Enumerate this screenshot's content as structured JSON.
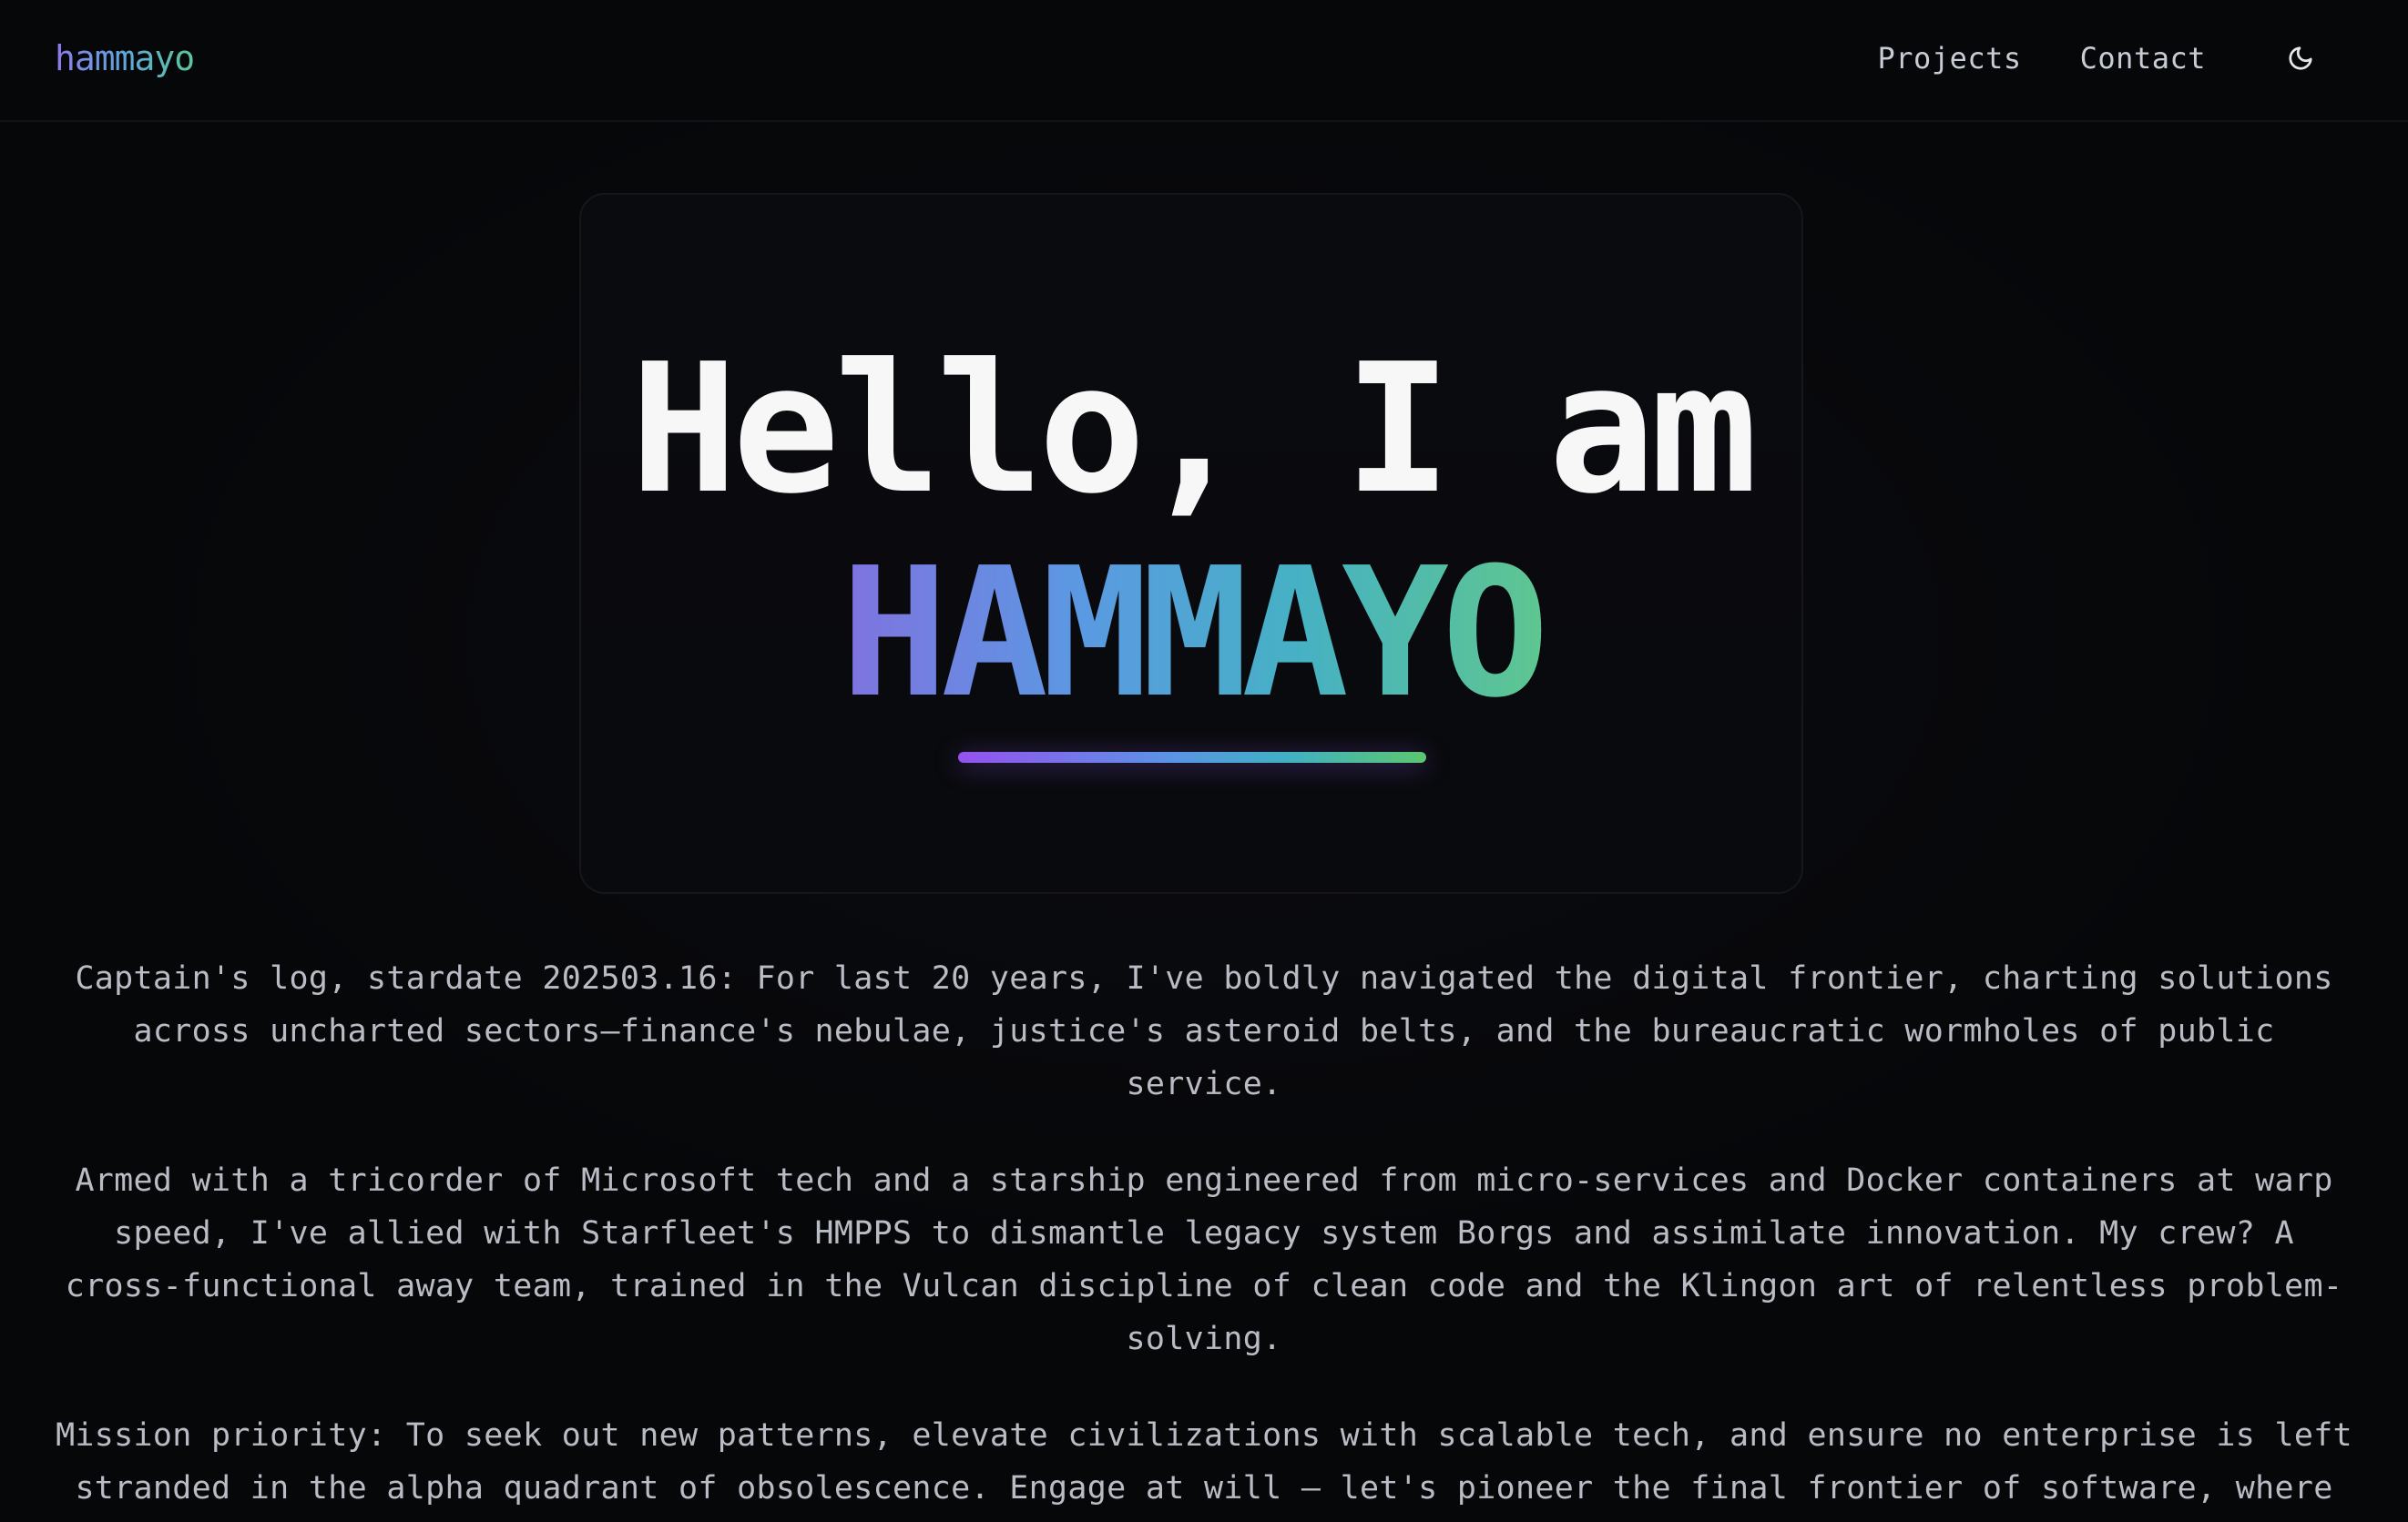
{
  "header": {
    "logo": "hammayo",
    "nav": [
      {
        "label": "Projects"
      },
      {
        "label": "Contact"
      }
    ],
    "theme_toggle_icon": "moon-icon"
  },
  "hero": {
    "greeting": "Hello, I am",
    "name": "HAMMAYO"
  },
  "bio": {
    "paragraphs": [
      "Captain's log, stardate 202503.16: For last 20 years, I've boldly navigated the digital frontier, charting solutions across uncharted sectors—finance's nebulae, justice's asteroid belts, and the bureaucratic wormholes of public service.",
      "Armed with a tricorder of Microsoft tech and a starship engineered from micro-services and Docker containers at warp speed, I've allied with Starfleet's HMPPS to dismantle legacy system Borgs and assimilate innovation. My crew? A cross-functional away team, trained in the Vulcan discipline of clean code and the Klingon art of relentless problem-solving.",
      "Mission priority: To seek out new patterns, elevate civilizations with scalable tech, and ensure no enterprise is left stranded in the alpha quadrant of obsolescence. Engage at will — let's pioneer the final frontier of software, where no challenge has gone before. 🖖"
    ]
  },
  "colors": {
    "background": "#07080a",
    "accent_start": "#8f79e8",
    "accent_mid": "#5ea8da",
    "accent_end": "#5cc69a"
  }
}
